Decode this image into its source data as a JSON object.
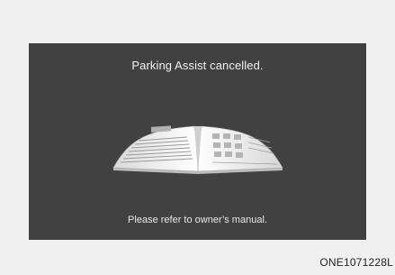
{
  "screen": {
    "title": "Parking Assist cancelled.",
    "message": "Please refer to owner’s manual.",
    "illustration_icon": "open-book-icon"
  },
  "figure": {
    "code": "ONE1071228L"
  },
  "colors": {
    "page_background": "#f0f0f0",
    "screen_background": "#414141",
    "text": "#f4f4f4"
  }
}
